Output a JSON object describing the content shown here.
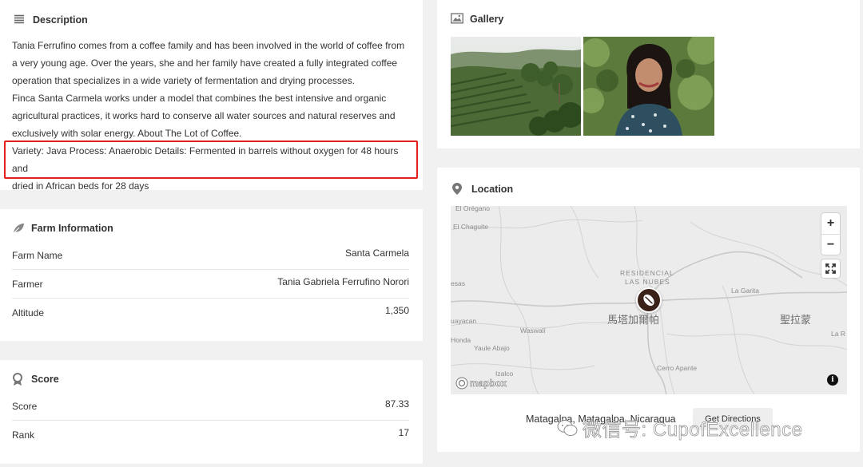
{
  "description": {
    "title": "Description",
    "paragraph1_line1": "Tania Ferrufino comes from a coffee family and has been involved in the world of coffee from",
    "paragraph1_line2": "a very young age. Over the years, she and her family have created a fully integrated coffee",
    "paragraph1_line3": "operation that specializes in a wide variety of fermentation and drying processes.",
    "paragraph2_line1": "Finca Santa Carmela works under a model that combines the best intensive and organic",
    "paragraph2_line2": "agricultural practices, it works hard to conserve all water sources and natural reserves and",
    "paragraph2_line3": "exclusively with solar energy. About The Lot of Coffee.",
    "variety_line1": "Variety: Java Process: Anaerobic Details: Fermented in barrels without oxygen for 48 hours and",
    "variety_line2": "dried in African beds for 28 days",
    "highlight_color": "#e2211c"
  },
  "farm": {
    "title": "Farm Information",
    "rows": [
      {
        "label": "Farm Name",
        "value": "Santa Carmela"
      },
      {
        "label": "Farmer",
        "value": "Tania Gabriela Ferrufino Norori"
      },
      {
        "label": "Altitude",
        "value": "1,350"
      }
    ]
  },
  "score": {
    "title": "Score",
    "rows": [
      {
        "label": "Score",
        "value": "87.33"
      },
      {
        "label": "Rank",
        "value": "17"
      }
    ]
  },
  "gallery": {
    "title": "Gallery"
  },
  "location": {
    "title": "Location",
    "map_labels": {
      "el_oregano": "El Orégano",
      "el_chaguite": "El Chaguite",
      "residencial": "RESIDENCIAL",
      "las_nubes": "LAS NUBES",
      "la_garita": "La Garita",
      "esas": "esas",
      "guayacan": "uayacan",
      "waswali": "Waswalí",
      "honda": "Honda",
      "yaule_abajo": "Yaule Abajo",
      "izalco": "Izalco",
      "cerro_apante": "Cerro Apante",
      "la_r": "La R",
      "matagalpa_cjk": "馬塔加爾帕",
      "shengla_cjk": "聖拉蒙"
    },
    "zoom_in": "+",
    "zoom_out": "−",
    "mapbox_text": "mapbox",
    "info_text": "i",
    "address": "Matagalpa, Matagalpa, Nicaragua",
    "directions_label": "Get Directions"
  },
  "watermark": "微信号: CupofExcellence",
  "colors": {
    "page_bg": "#f1f1f1",
    "card_bg": "#ffffff",
    "pin_bg": "#3a2119"
  }
}
